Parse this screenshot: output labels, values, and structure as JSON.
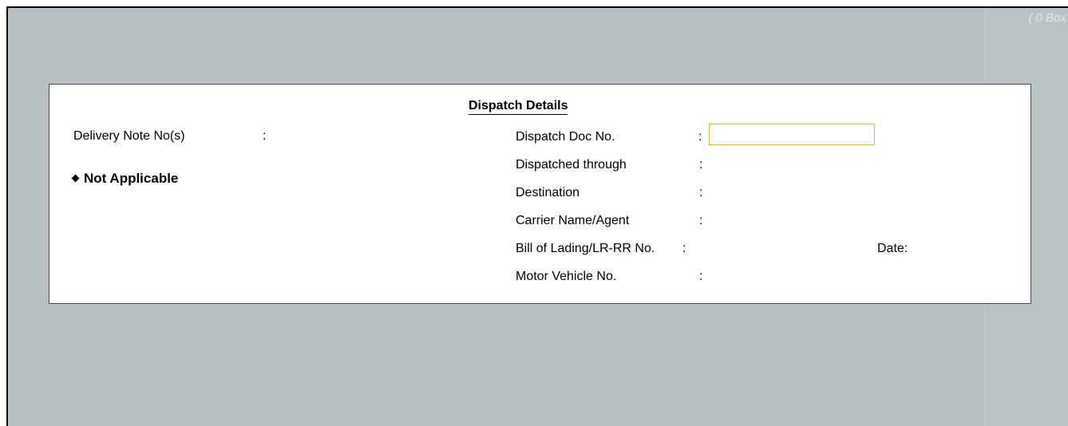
{
  "boxes_label": "( 0 Box",
  "panel": {
    "title": "Dispatch Details",
    "delivery_note_label": "Delivery Note No(s)",
    "delivery_note_colon": ":",
    "not_applicable": "Not Applicable",
    "fields": [
      {
        "label": "Dispatch Doc No.",
        "colon": ":",
        "value": ""
      },
      {
        "label": "Dispatched through",
        "colon": ":"
      },
      {
        "label": "Destination",
        "colon": ":"
      },
      {
        "label": "Carrier Name/Agent",
        "colon": ":"
      },
      {
        "label": "Bill of Lading/LR-RR No.",
        "colon": ":"
      },
      {
        "label": "Motor Vehicle No.",
        "colon": ":"
      }
    ],
    "date_label": "Date:"
  }
}
